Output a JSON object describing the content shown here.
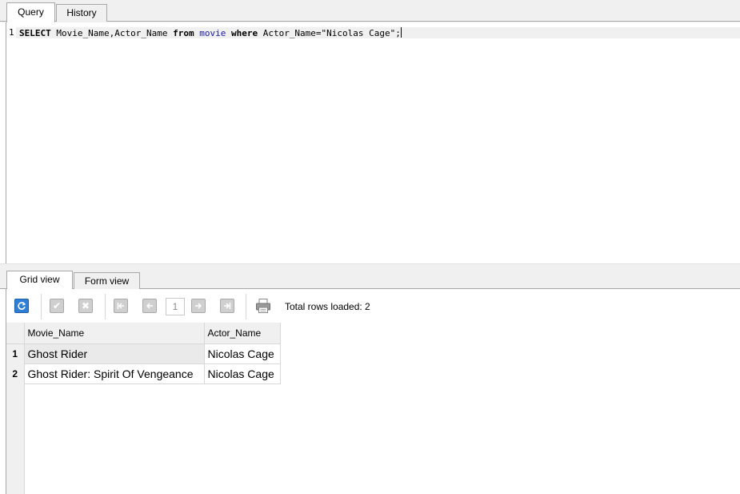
{
  "query_tabs": {
    "query": "Query",
    "history": "History"
  },
  "editor": {
    "line_number": "1",
    "tokens": {
      "select": "SELECT",
      "columns": " Movie_Name,Actor_Name ",
      "from": "from",
      "space1": " ",
      "table": "movie",
      "space2": " ",
      "where": "where",
      "condition": " Actor_Name=\"Nicolas Cage\";"
    }
  },
  "result_tabs": {
    "grid": "Grid view",
    "form": "Form view"
  },
  "toolbar": {
    "refresh_icon": "refresh-icon",
    "check_icon": "check-icon",
    "cancel_icon": "cancel-icon",
    "first_icon": "first-page-icon",
    "prev_icon": "prev-page-icon",
    "page": "1",
    "next_icon": "next-page-icon",
    "last_icon": "last-page-icon",
    "print_icon": "print-icon",
    "total_rows": "Total rows loaded: 2"
  },
  "grid": {
    "columns": [
      "Movie_Name",
      "Actor_Name"
    ],
    "rows": [
      {
        "num": "1",
        "cells": [
          "Ghost Rider",
          "Nicolas Cage"
        ]
      },
      {
        "num": "2",
        "cells": [
          "Ghost Rider: Spirit Of Vengeance",
          "Nicolas Cage"
        ]
      }
    ]
  },
  "colors": {
    "accent": "#2f7fd6",
    "keyword_table": "#1a1aa6",
    "panel_bg": "#f0f0f0"
  }
}
